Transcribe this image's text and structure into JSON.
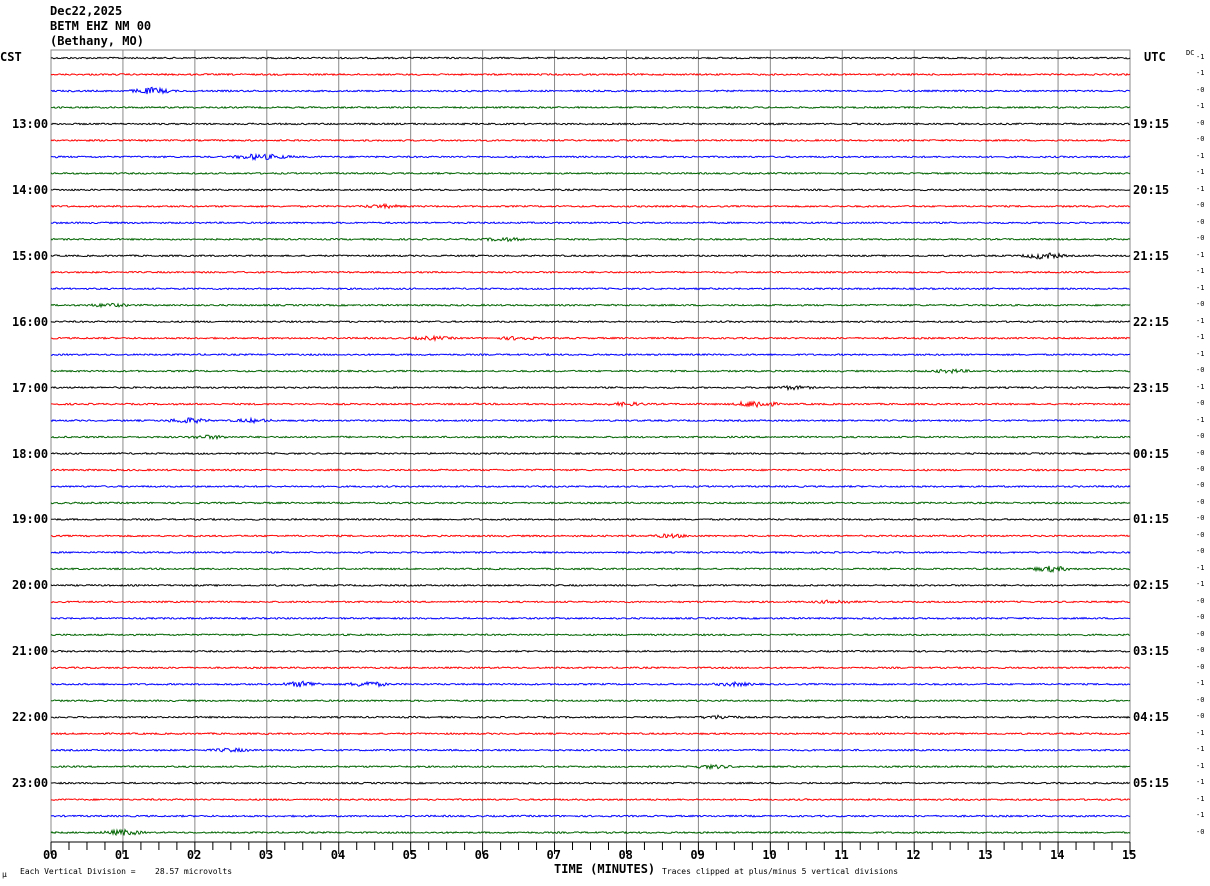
{
  "header": {
    "date": "Dec22,2025",
    "station": "BETM EHZ NM 00",
    "location": "(Bethany, MO)"
  },
  "chart_data": {
    "type": "line",
    "title": "BETM EHZ NM 00 helicorder Dec22,2025",
    "left_tz": "CST",
    "right_tz": "UTC",
    "dc_label": "DC",
    "left_labels": [
      "13:00",
      "14:00",
      "15:00",
      "16:00",
      "17:00",
      "18:00",
      "19:00",
      "20:00",
      "21:00",
      "22:00",
      "23:00"
    ],
    "right_labels": [
      "19:15",
      "20:15",
      "21:15",
      "22:15",
      "23:15",
      "00:15",
      "01:15",
      "02:15",
      "03:15",
      "04:15",
      "05:15"
    ],
    "x_ticks": [
      "00",
      "01",
      "02",
      "03",
      "04",
      "05",
      "06",
      "07",
      "08",
      "09",
      "10",
      "11",
      "12",
      "13",
      "14",
      "15"
    ],
    "xlabel": "TIME (MINUTES)",
    "xlim": [
      0,
      15
    ],
    "trace_colors": [
      "#000000",
      "#ff0000",
      "#0000ff",
      "#006400"
    ],
    "dc_offsets": [
      "-1",
      "-1",
      "-0",
      "-1",
      "-0",
      "-0",
      "-1",
      "-1",
      "-1",
      "-0",
      "-0",
      "-0",
      "-1",
      "-1",
      "-1",
      "-0",
      "-1",
      "-1",
      "-1",
      "-0",
      "-1",
      "-0",
      "-1",
      "-0",
      "-0",
      "-0",
      "-0",
      "-0",
      "-0",
      "-0",
      "-0",
      "-1",
      "-1",
      "-0",
      "-0",
      "-0",
      "-0",
      "-0",
      "-1",
      "-0",
      "-0",
      "-1",
      "-1",
      "-1",
      "-1",
      "-1",
      "-1",
      "-0"
    ],
    "events": [
      [
        2,
        1.4,
        6
      ],
      [
        6,
        2.8,
        4
      ],
      [
        6,
        3.1,
        3
      ],
      [
        9,
        4.6,
        3
      ],
      [
        11,
        6.3,
        3
      ],
      [
        12,
        13.8,
        6
      ],
      [
        15,
        0.8,
        3
      ],
      [
        17,
        5.3,
        3
      ],
      [
        17,
        6.5,
        3
      ],
      [
        19,
        12.5,
        3
      ],
      [
        20,
        10.3,
        3
      ],
      [
        21,
        9.8,
        7
      ],
      [
        21,
        8.0,
        3
      ],
      [
        22,
        1.9,
        5
      ],
      [
        22,
        2.8,
        3
      ],
      [
        23,
        2.2,
        3
      ],
      [
        29,
        8.6,
        3
      ],
      [
        31,
        13.9,
        5
      ],
      [
        33,
        10.9,
        3
      ],
      [
        38,
        3.5,
        5
      ],
      [
        38,
        4.4,
        5
      ],
      [
        38,
        9.5,
        3
      ],
      [
        40,
        9.3,
        3
      ],
      [
        42,
        2.5,
        3
      ],
      [
        43,
        9.2,
        3
      ],
      [
        47,
        1.0,
        5
      ]
    ],
    "footer": {
      "scale_label": "Each Vertical Division =",
      "scale_value": "28.57 microvolts",
      "clip_note": "Traces clipped at plus/minus 5 vertical divisions"
    }
  }
}
